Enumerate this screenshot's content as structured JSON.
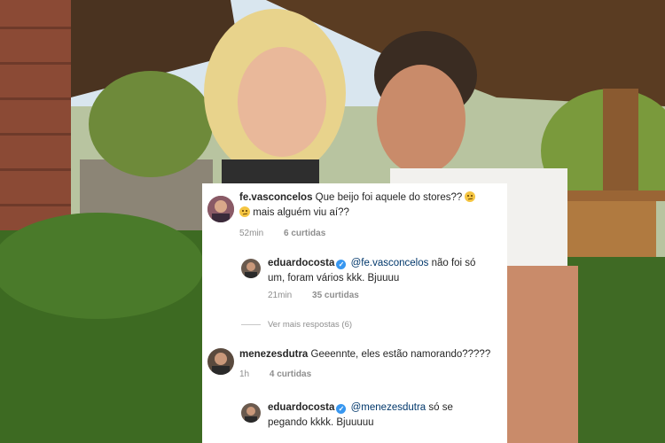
{
  "comments": [
    {
      "username": "fe.vasconcelos",
      "text_before_emoji": "Que beijo foi aquele do stores??",
      "text_line2": "mais alguém viu aí??",
      "time": "52min",
      "likes": "6 curtidas",
      "avatar_icon": "profile-photo-woman"
    },
    {
      "username": "eduardocosta",
      "verified": true,
      "mention": "@fe.vasconcelos",
      "text": "não foi só",
      "text_line2": "um, foram vários kkk. Bjuuuu",
      "time": "21min",
      "likes": "35 curtidas",
      "avatar_icon": "profile-photo-man"
    },
    {
      "more_replies": "Ver mais respostas (6)"
    },
    {
      "username": "menezesdutra",
      "text": "Geeennte, eles estão namorando?????",
      "time": "1h",
      "likes": "4 curtidas",
      "avatar_icon": "profile-photo-man"
    },
    {
      "username": "eduardocosta",
      "verified": true,
      "mention": "@menezesdutra",
      "text": "só se",
      "text_line2": "pegando kkkk. Bjuuuuu",
      "avatar_icon": "profile-photo-man"
    }
  ],
  "colors": {
    "text": "#262626",
    "meta": "#8e8e8e",
    "mention": "#00376b",
    "verified": "#3897f0",
    "panel_bg": "#ffffff"
  }
}
